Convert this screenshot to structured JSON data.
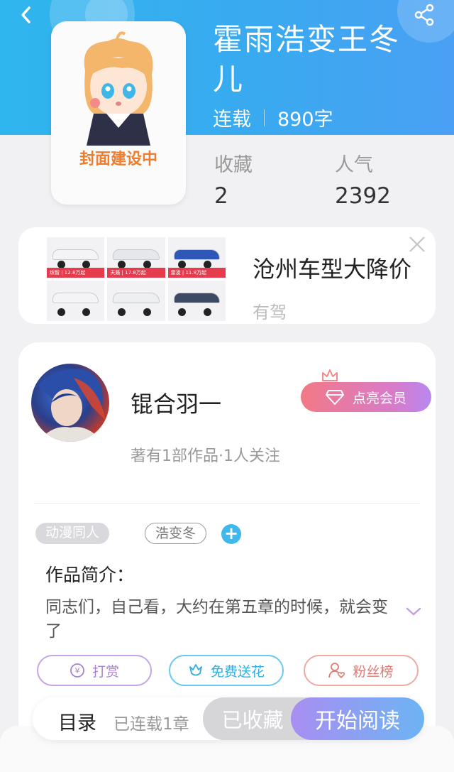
{
  "book": {
    "title": "霍雨浩变王冬儿",
    "status": "连载",
    "word_count": "890字",
    "cover_placeholder": "封面建设中",
    "stats": [
      {
        "label": "收藏",
        "value": "2"
      },
      {
        "label": "人气",
        "value": "2392"
      }
    ]
  },
  "ad": {
    "title": "沧州车型大降价",
    "source": "有驾",
    "cars": [
      {
        "color": "#f4f4f6",
        "price": "缤智 | 12.8万起"
      },
      {
        "color": "#e6e7ea",
        "price": "天籁 | 17.8万起"
      },
      {
        "color": "#2f57b8",
        "price": "雷凌 | 11.8万起"
      },
      {
        "color": "#f4f4f6",
        "price": ""
      },
      {
        "color": "#eeeff1",
        "price": ""
      },
      {
        "color": "#3d4a66",
        "price": ""
      }
    ]
  },
  "author": {
    "name": "锟合羽一",
    "vip_label": "点亮会员",
    "stats": "著有1部作品·1人关注"
  },
  "tags": {
    "category": "动漫同人",
    "keyword": "浩变冬",
    "add": "+"
  },
  "intro": {
    "heading": "作品简介：",
    "text": "同志们，自己看，大约在第五章的时候，就会变了"
  },
  "actions": {
    "reward": "打赏",
    "flower": "免费送花",
    "fans": "粉丝榜"
  },
  "bottom": {
    "toc": "目录",
    "chapters": "已连载1章",
    "collected": "已收藏",
    "read": "开始阅读"
  },
  "colors": {
    "header": "#3aa9f0",
    "cover_label": "#f07d2c",
    "vip_gradient_start": "#f27a86",
    "read_gradient_start": "#a98ef2"
  }
}
